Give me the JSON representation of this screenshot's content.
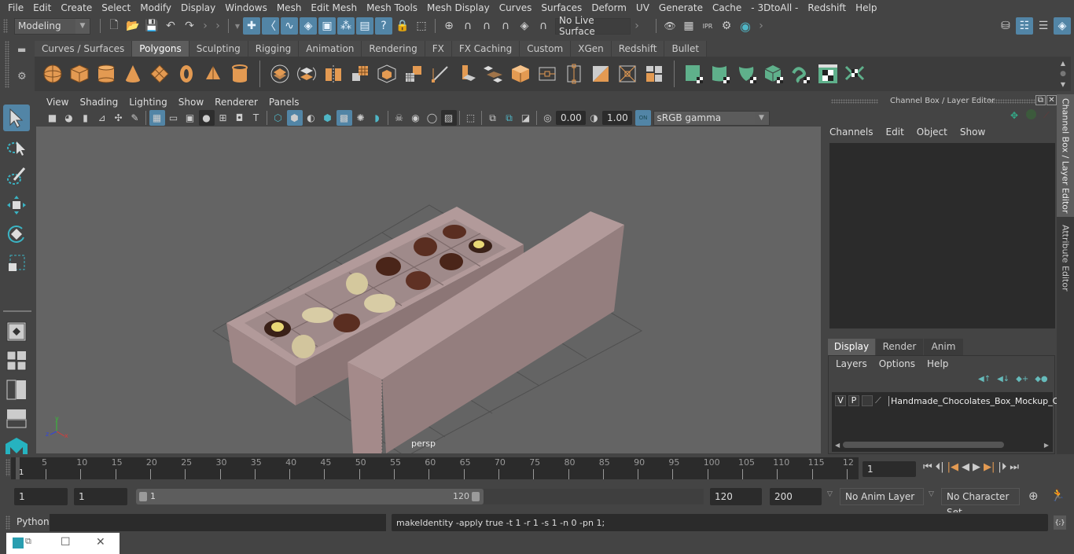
{
  "menubar": {
    "items": [
      "File",
      "Edit",
      "Create",
      "Select",
      "Modify",
      "Display",
      "Windows",
      "Mesh",
      "Edit Mesh",
      "Mesh Tools",
      "Mesh Display",
      "Curves",
      "Surfaces",
      "Deform",
      "UV",
      "Generate",
      "Cache",
      "- 3DtoAll -",
      "Redshift",
      "Help"
    ]
  },
  "statusline": {
    "mode": "Modeling",
    "live_surface": "No Live Surface",
    "icons": [
      "new-scene-icon",
      "open-scene-icon",
      "save-scene-icon",
      "undo-icon",
      "redo-icon",
      "select-by-hierarchy-icon",
      "select-by-object-icon",
      "select-by-component-icon",
      "snap-grid-icon",
      "snap-curve-icon",
      "snap-point-icon",
      "snap-view-plane-icon",
      "make-live-icon",
      "render-view-icon",
      "render-current-icon",
      "ipr-render-icon",
      "render-settings-icon",
      "hypershade-icon"
    ],
    "right_icons": [
      "modeling-toolkit-icon",
      "channel-box-toggle-icon",
      "attribute-editor-toggle-icon",
      "layer-toggle-icon"
    ]
  },
  "shelf": {
    "tabs": [
      "Curves / Surfaces",
      "Polygons",
      "Sculpting",
      "Rigging",
      "Animation",
      "Rendering",
      "FX",
      "FX Caching",
      "Custom",
      "XGen",
      "Redshift",
      "Bullet"
    ],
    "active_tab": "Polygons",
    "poly_icons": [
      "poly-sphere-icon",
      "poly-cube-icon",
      "poly-cylinder-icon",
      "poly-cone-icon",
      "poly-plane-icon",
      "poly-torus-icon",
      "poly-pyramid-icon",
      "poly-pipe-icon"
    ],
    "edit_icons": [
      "combine-icon",
      "separate-icon",
      "mirror-icon",
      "smooth-icon",
      "extract-icon",
      "subdivide-icon",
      "multi-cut-icon",
      "extrude-icon",
      "bridge-icon",
      "bevel-icon",
      "insert-edge-loop-icon",
      "offset-edge-loop-icon",
      "bridge-edge-icon",
      "merge-icon",
      "center-pivot-icon",
      "delete-history-icon"
    ],
    "uv_icons": [
      "planar-map-icon",
      "cylindrical-map-icon",
      "spherical-map-icon",
      "automatic-map-icon",
      "uv-unfold-icon",
      "uv-editor-icon",
      "uv-layout-icon"
    ]
  },
  "viewport": {
    "menu": [
      "View",
      "Shading",
      "Lighting",
      "Show",
      "Renderer",
      "Panels"
    ],
    "exposure": "0.00",
    "gamma": "1.00",
    "color_management": "ON",
    "color_space": "sRGB gamma",
    "camera_label": "persp",
    "axis": {
      "x": "x",
      "y": "y",
      "z": "z"
    }
  },
  "channel_box": {
    "title": "Channel Box / Layer Editor",
    "menu": [
      "Channels",
      "Edit",
      "Object",
      "Show"
    ],
    "layer_tabs": [
      "Display",
      "Render",
      "Anim"
    ],
    "active_layer_tab": "Display",
    "layer_menu": [
      "Layers",
      "Options",
      "Help"
    ],
    "layers": [
      {
        "v": "V",
        "p": "P",
        "name": "Handmade_Chocolates_Box_Mockup_Op"
      }
    ]
  },
  "side_tabs": [
    "Channel Box / Layer Editor",
    "Attribute Editor"
  ],
  "timeline": {
    "ticks": [
      "5",
      "10",
      "15",
      "20",
      "25",
      "30",
      "35",
      "40",
      "45",
      "50",
      "55",
      "60",
      "65",
      "70",
      "75",
      "80",
      "85",
      "90",
      "95",
      "100",
      "105",
      "110",
      "115",
      "12"
    ],
    "current_marker": "1",
    "current_frame": "1"
  },
  "range": {
    "start": "1",
    "anim_start": "1",
    "slider_start": "1",
    "slider_end": "120",
    "end": "120",
    "anim_end": "200",
    "anim_layer": "No Anim Layer",
    "character_set": "No Character Set"
  },
  "command": {
    "language": "Python",
    "input": "",
    "result": "makeIdentity -apply true -t 1 -r 1 -s 1 -n 0 -pn 1;"
  },
  "colors": {
    "accent": "#5285a6",
    "shelf_orange": "#e39a52",
    "shelf_green": "#5fb08b",
    "box_pink": "#a48a8a",
    "maya_teal": "#26b3c0"
  }
}
